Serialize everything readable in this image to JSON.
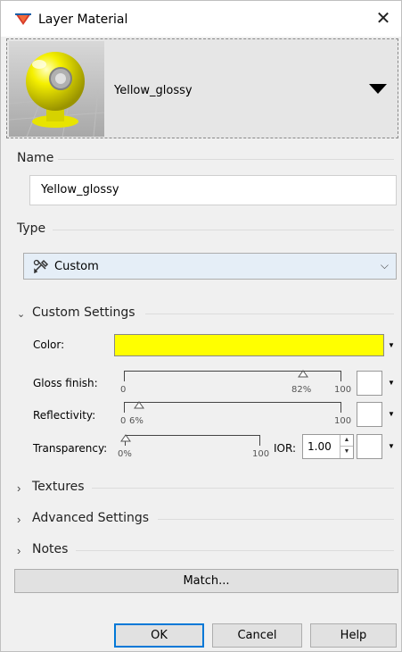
{
  "window": {
    "title": "Layer Material",
    "close_glyph": "✕"
  },
  "preview": {
    "material_name": "Yellow_glossy",
    "dropdown_icon": "triangle-down-icon"
  },
  "name_group": {
    "label": "Name",
    "value": "Yellow_glossy"
  },
  "type_group": {
    "label": "Type",
    "selected": "Custom",
    "icon": "custom-material-icon",
    "arrow": "⌵"
  },
  "custom_settings": {
    "header": "Custom Settings",
    "expanded": true,
    "color_label": "Color:",
    "color_value": "#ffff00",
    "gloss": {
      "label": "Gloss finish:",
      "min": "0",
      "max": "100",
      "value_label": "82%",
      "value": 82
    },
    "reflectivity": {
      "label": "Reflectivity:",
      "min": "0",
      "max": "100",
      "value_label": "6%",
      "value": 6
    },
    "transparency": {
      "label": "Transparency:",
      "value_label": "0%",
      "max": "100",
      "value": 0
    },
    "ior": {
      "label": "IOR:",
      "value": "1.00"
    }
  },
  "sections": {
    "textures": "Textures",
    "advanced": "Advanced Settings",
    "notes": "Notes"
  },
  "buttons": {
    "match": "Match...",
    "ok": "OK",
    "cancel": "Cancel",
    "help": "Help"
  }
}
